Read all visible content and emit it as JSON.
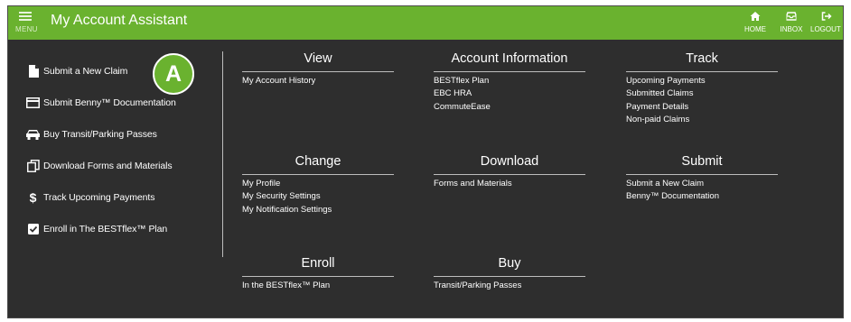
{
  "topbar": {
    "menu_label": "MENU",
    "title": "My Account Assistant",
    "nav": [
      {
        "label": "HOME",
        "icon": "home-icon"
      },
      {
        "label": "INBOX",
        "icon": "inbox-icon"
      },
      {
        "label": "LOGOUT",
        "icon": "logout-icon"
      }
    ]
  },
  "sidebar": {
    "items": [
      {
        "label": "Submit a New Claim",
        "icon": "document-icon"
      },
      {
        "label": "Submit Benny™ Documentation",
        "icon": "card-icon"
      },
      {
        "label": "Buy Transit/Parking Passes",
        "icon": "car-icon"
      },
      {
        "label": "Download Forms and Materials",
        "icon": "copy-icon"
      },
      {
        "label": "Track Upcoming Payments",
        "icon": "dollar-icon"
      },
      {
        "label": "Enroll in The BESTflex™ Plan",
        "icon": "checkbox-icon"
      }
    ]
  },
  "callout": {
    "label": "A"
  },
  "sections": [
    {
      "title": "View",
      "links": [
        "My Account History"
      ]
    },
    {
      "title": "Account Information",
      "links": [
        "BESTflex Plan",
        "EBC HRA",
        "CommuteEase"
      ]
    },
    {
      "title": "Track",
      "links": [
        "Upcoming Payments",
        "Submitted Claims",
        "Payment Details",
        "Non-paid Claims"
      ]
    },
    {
      "title": "Change",
      "links": [
        "My Profile",
        "My Security Settings",
        "My Notification Settings"
      ]
    },
    {
      "title": "Download",
      "links": [
        "Forms and Materials"
      ]
    },
    {
      "title": "Submit",
      "links": [
        "Submit a New Claim",
        "Benny™ Documentation"
      ]
    },
    {
      "title": "Enroll",
      "links": [
        "In the BESTflex™ Plan"
      ]
    },
    {
      "title": "Buy",
      "links": [
        "Transit/Parking Passes"
      ]
    }
  ],
  "colors": {
    "accent": "#6ab22f",
    "background": "#2e2e2e",
    "text": "#ffffff"
  }
}
